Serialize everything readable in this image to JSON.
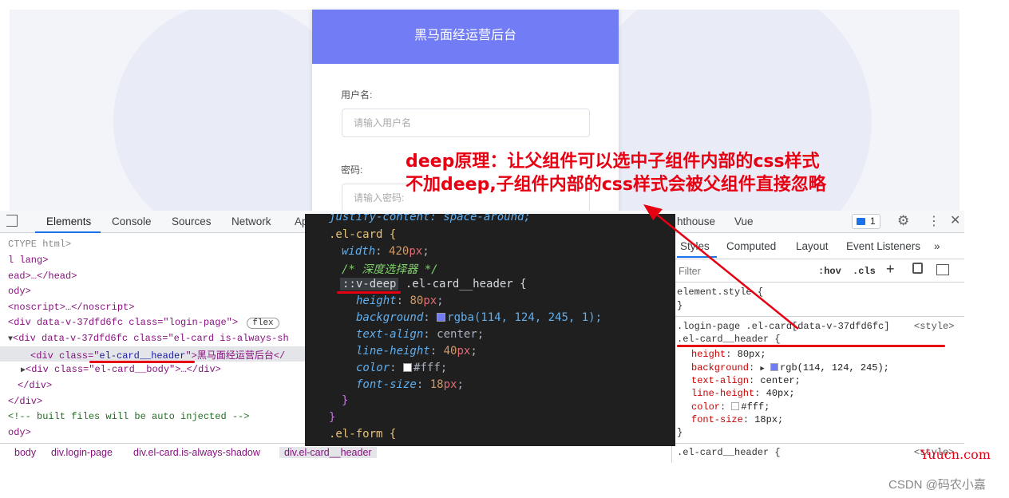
{
  "login": {
    "card_title": "黑马面经运营后台",
    "username_label": "用户名:",
    "username_placeholder": "请输入用户名",
    "password_label": "密码:",
    "password_placeholder": "请输入密码:"
  },
  "annotation": {
    "line1": "deep原理：让父组件可以选中子组件内部的css样式",
    "line2": "不加deep,子组件内部的css样式会被父组件直接忽略"
  },
  "devtools": {
    "tabs": [
      "Elements",
      "Console",
      "Sources",
      "Network",
      "Ap",
      "hthouse",
      "Vue"
    ],
    "issues_count": "1",
    "dom_lines": {
      "doctype": "CTYPE html>",
      "html": "l lang>",
      "head": "ead>…</head>",
      "body": "ody>",
      "noscript": "<noscript>…</noscript>",
      "login_div_open": "<div data-v-37dfd6fc class=\"login-page\">",
      "flex_badge": "flex",
      "card_div": "<div data-v-37dfd6fc class=\"el-card is-always-sh",
      "header_div_prefix": "<div class=\"",
      "header_div_class": "el-card__header",
      "header_div_suffix": "\">黑马面经运营后台</",
      "body_div": "<div class=\"el-card__body\">…</div>",
      "close_div_1": "</div>",
      "close_div_2": "</div>",
      "comment": "<!-- built files will be auto injected -->",
      "body_close": "ody>"
    },
    "breadcrumbs": [
      "body",
      "div.login-page",
      "div.el-card.is-always-shadow",
      "div.el-card__header"
    ],
    "styles_tabs": [
      "Styles",
      "Computed",
      "Layout",
      "Event Listeners",
      "»"
    ],
    "filter_placeholder": "Filter",
    "hov": ":hov",
    "cls": ".cls",
    "element_style": "element.style {",
    "rule1_selector_line": ".login-page .el-card[data-v-37dfd6fc]",
    "rule1_source": "<style>",
    "rule1_selector_tail": ".el-card__header {",
    "rule1_props": [
      {
        "name": "height",
        "value": "80px;"
      },
      {
        "name": "background",
        "value": "rgb(114, 124, 245);"
      },
      {
        "name": "text-align",
        "value": "center;"
      },
      {
        "name": "line-height",
        "value": "40px;"
      },
      {
        "name": "color",
        "value": "#fff;"
      },
      {
        "name": "font-size",
        "value": "18px;"
      }
    ],
    "rule2_selector": ".el-card__header {",
    "rule2_source": "<style>"
  },
  "code": {
    "line0": "justify-content: space-around;",
    "card_selector": ".el-card {",
    "width_prop": "width",
    "width_num": "420",
    "comment": "/* 深度选择器 */",
    "deep": "::v-deep",
    "header_selector": ".el-card__header {",
    "height_prop": "height",
    "height_num": "80",
    "bg_prop": "background",
    "bg_value": "rgba(114, 124, 245, 1);",
    "align_prop": "text-align",
    "align_value": "center;",
    "lh_prop": "line-height",
    "lh_num": "40",
    "color_prop": "color",
    "color_value": "#fff;",
    "fs_prop": "font-size",
    "fs_num": "18",
    "unit": "px",
    "semicolon": ";",
    "colon": ":",
    "close_inner": "}",
    "close_outer": "}",
    "form_selector": ".el-form {"
  },
  "watermarks": {
    "site": "Yuucn.com",
    "csdn": "CSDN @码农小嘉"
  },
  "colors": {
    "accent": "#727cf5",
    "annotation": "#e60012"
  }
}
